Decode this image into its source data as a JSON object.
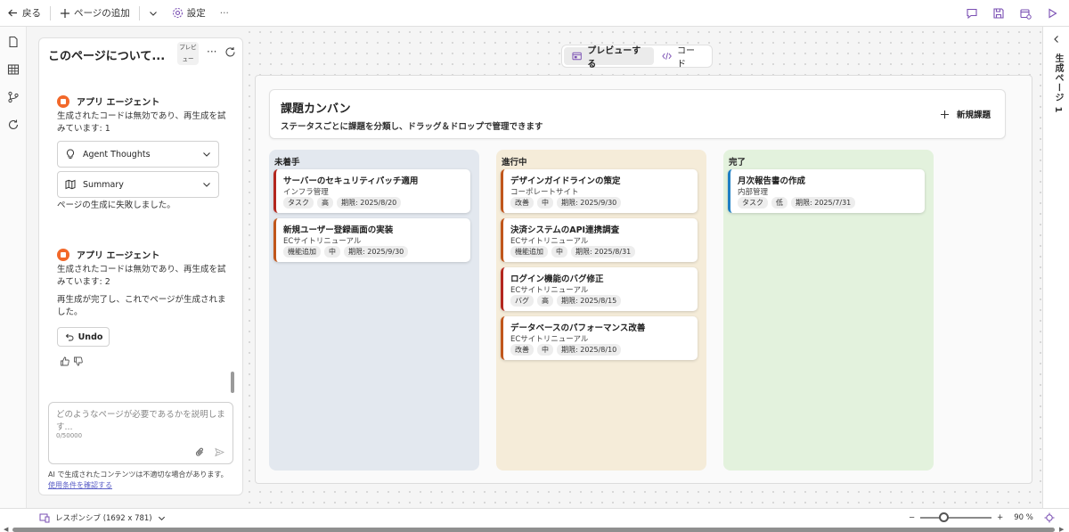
{
  "toolbar": {
    "back": "戻る",
    "add_page": "ページの追加",
    "settings": "設定",
    "more": "···"
  },
  "chat": {
    "title": "このページについて...",
    "badge": "プレビュー",
    "more": "···",
    "agent_name": "アプリ エージェント",
    "msg1": "生成されたコードは無効であり、再生成を試みています: 1",
    "dropdown_thoughts": "Agent Thoughts",
    "dropdown_summary": "Summary",
    "fail": "ページの生成に失敗しました。",
    "msg2": "生成されたコードは無効であり、再生成を試みています: 2",
    "done": "再生成が完了し、これでページが生成されました。",
    "undo": "Undo",
    "input_placeholder": "どのようなページが必要であるかを説明します...",
    "counter": "0/50000",
    "disclaimer": "AI で生成されたコンテンツは不適切な場合があります。",
    "terms_link": "使用条件を確認する"
  },
  "view_toggle": {
    "preview": "プレビューする",
    "code": "コード"
  },
  "kanban": {
    "title": "課題カンバン",
    "subtitle": "ステータスごとに課題を分類し、ドラッグ＆ドロップで管理できます",
    "new_issue": "新規課題",
    "columns": [
      {
        "title": "未着手",
        "bg": "#e3e8ef",
        "cards": [
          {
            "title": "サーバーのセキュリティパッチ適用",
            "project": "インフラ管理",
            "type": "タスク",
            "priority": "高",
            "due": "期限: 2025/8/20",
            "accent": "#b3261e"
          },
          {
            "title": "新規ユーザー登録画面の実装",
            "project": "ECサイトリニューアル",
            "type": "機能追加",
            "priority": "中",
            "due": "期限: 2025/9/30",
            "accent": "#c0561b"
          }
        ]
      },
      {
        "title": "進行中",
        "bg": "#f5ecd9",
        "cards": [
          {
            "title": "デザインガイドラインの策定",
            "project": "コーポレートサイト",
            "type": "改善",
            "priority": "中",
            "due": "期限: 2025/9/30",
            "accent": "#c0561b"
          },
          {
            "title": "決済システムのAPI連携調査",
            "project": "ECサイトリニューアル",
            "type": "機能追加",
            "priority": "中",
            "due": "期限: 2025/8/31",
            "accent": "#c0561b"
          },
          {
            "title": "ログイン機能のバグ修正",
            "project": "ECサイトリニューアル",
            "type": "バグ",
            "priority": "高",
            "due": "期限: 2025/8/15",
            "accent": "#b3261e"
          },
          {
            "title": "データベースのパフォーマンス改善",
            "project": "ECサイトリニューアル",
            "type": "改善",
            "priority": "中",
            "due": "期限: 2025/8/10",
            "accent": "#c0561b"
          }
        ]
      },
      {
        "title": "完了",
        "bg": "#e3f2dd",
        "cards": [
          {
            "title": "月次報告書の作成",
            "project": "内部管理",
            "type": "タスク",
            "priority": "低",
            "due": "期限: 2025/7/31",
            "accent": "#1f7fc4"
          }
        ]
      }
    ]
  },
  "right_panel": {
    "label": "生成ページ 1"
  },
  "bottombar": {
    "responsive": "レスポンシブ (1692 x 781)",
    "zoom_minus": "−",
    "zoom_plus": "+",
    "zoom_level": "90 %",
    "zoom_value": 0.3
  },
  "colors": {
    "accent_purple": "#7a4fb3",
    "link": "#5b5fc7"
  }
}
